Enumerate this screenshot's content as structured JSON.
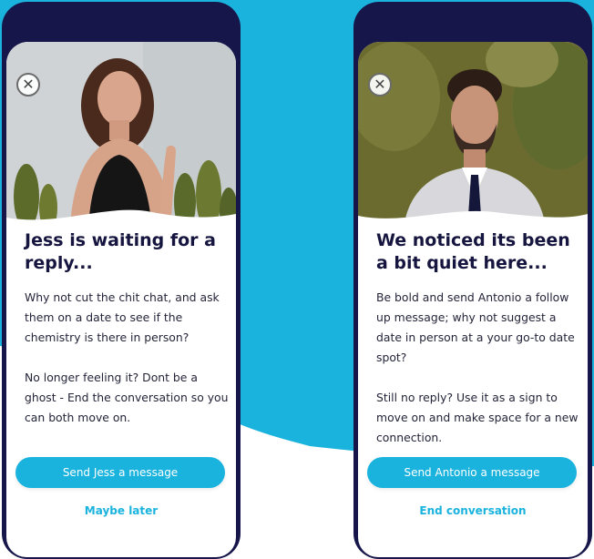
{
  "colors": {
    "background_wave": "#1ab3de",
    "phone_frame": "#16164a",
    "title_text": "#15153f",
    "accent": "#1ab3de"
  },
  "cards": [
    {
      "close_icon": "close-icon",
      "photo": "woman-smiling-photo",
      "title": "Jess is waiting for a reply...",
      "paragraphs": [
        "Why not cut the chit chat, and ask them on a date to see if the chemistry is there in person?",
        "No longer feeling it? Dont be a ghost - End the conversation so you can both move on."
      ],
      "primary_button": "Send Jess a message",
      "secondary_link": "Maybe later"
    },
    {
      "close_icon": "close-icon",
      "photo": "man-in-suit-photo",
      "title": "We noticed its been a bit quiet here...",
      "paragraphs": [
        "Be bold and send Antonio a follow up message; why not suggest a date in person at a your go-to date spot?",
        "Still no reply? Use it as a sign to move on and make space for a new connection."
      ],
      "primary_button": "Send Antonio a message",
      "secondary_link": "End conversation"
    }
  ]
}
